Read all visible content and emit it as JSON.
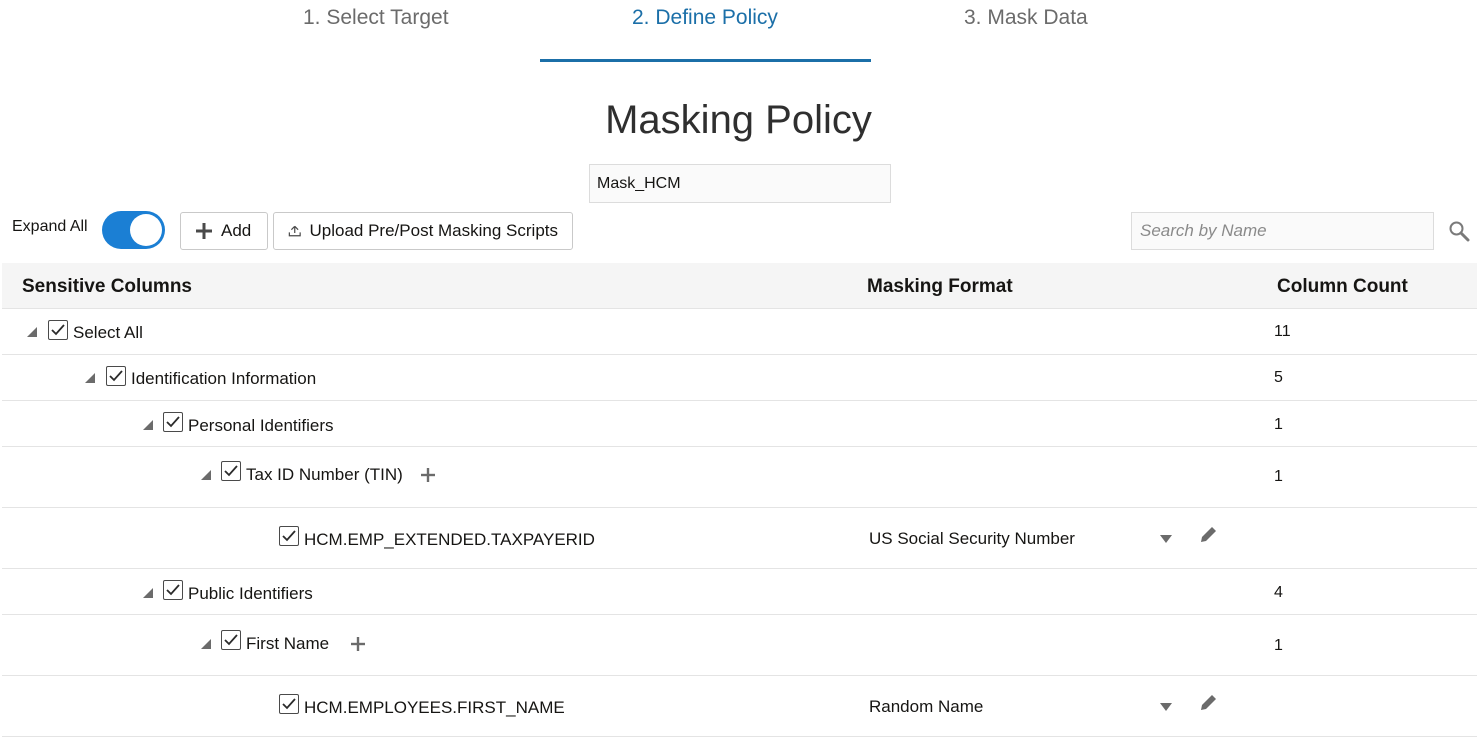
{
  "steps": [
    {
      "label": "1. Select Target"
    },
    {
      "label": "2. Define Policy"
    },
    {
      "label": "3. Mask Data"
    }
  ],
  "page_title": "Masking Policy",
  "policy_name": "Mask_HCM",
  "toolbar": {
    "expand_all_label": "Expand All",
    "expand_all_on": true,
    "add_label": "Add",
    "upload_label": "Upload Pre/Post Masking Scripts",
    "search_placeholder": "Search by Name"
  },
  "columns": {
    "sensitive": "Sensitive Columns",
    "format": "Masking Format",
    "count": "Column Count"
  },
  "rows": [
    {
      "label": "Select All",
      "count": "11",
      "checked": true
    },
    {
      "label": "Identification Information",
      "count": "5",
      "checked": true
    },
    {
      "label": "Personal Identifiers",
      "count": "1",
      "checked": true
    },
    {
      "label": "Tax ID Number (TIN)",
      "count": "1",
      "checked": true
    },
    {
      "label": "HCM.EMP_EXTENDED.TAXPAYERID",
      "format": "US Social Security Number",
      "checked": true
    },
    {
      "label": "Public Identifiers",
      "count": "4",
      "checked": true
    },
    {
      "label": "First Name",
      "count": "1",
      "checked": true
    },
    {
      "label": "HCM.EMPLOYEES.FIRST_NAME",
      "format": "Random Name",
      "checked": true
    }
  ],
  "colors": {
    "accent": "#1b6fa8",
    "toggle": "#1b7fd4"
  }
}
